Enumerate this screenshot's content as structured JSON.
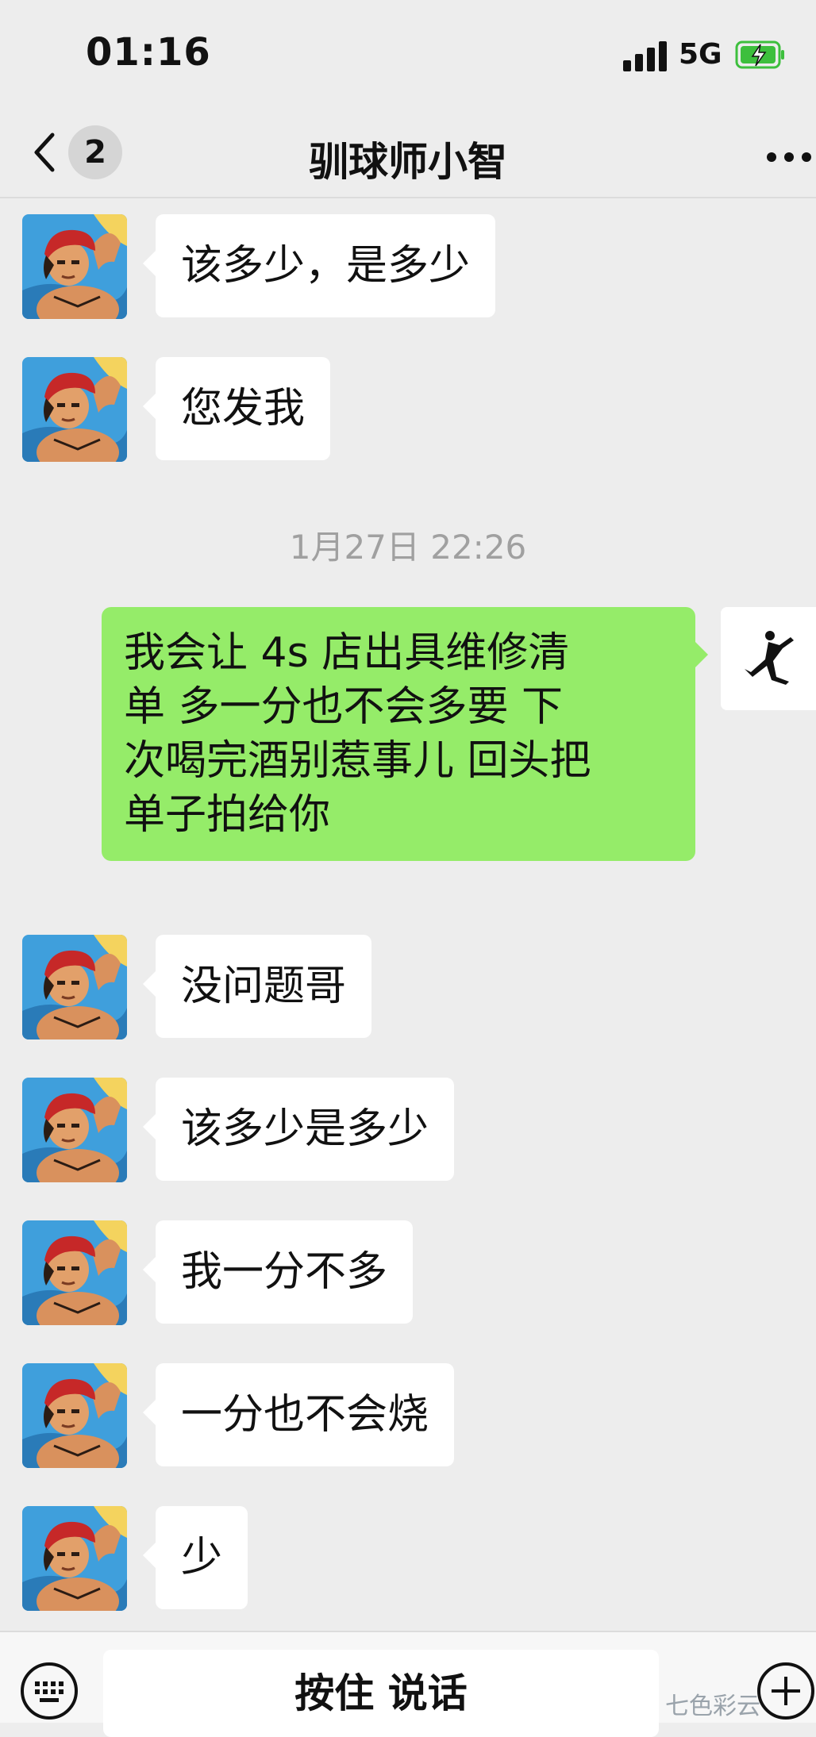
{
  "status_bar": {
    "time": "01:16",
    "network": "5G"
  },
  "nav": {
    "unread_count": "2",
    "title": "驯球师小智"
  },
  "messages_before": [
    {
      "text": "该多少，是多少"
    },
    {
      "text": "您发我"
    }
  ],
  "timestamp": "1月27日 22:26",
  "self_message": {
    "lines": [
      "我会让 4s 店出具维修清",
      "单 多一分也不会多要 下",
      "次喝完酒别惹事儿 回头把",
      "单子拍给你"
    ]
  },
  "messages_after": [
    {
      "text": "没问题哥"
    },
    {
      "text": "该多少是多少"
    },
    {
      "text": "我一分不多"
    },
    {
      "text": "一分也不会烧"
    },
    {
      "text": "少"
    }
  ],
  "input_bar": {
    "hold_to_talk": "按住 说话"
  },
  "watermark": "七色彩云",
  "colors": {
    "background": "#ededed",
    "self_bubble": "#95ec69",
    "other_bubble": "#ffffff",
    "battery": "#3dbf3d"
  }
}
